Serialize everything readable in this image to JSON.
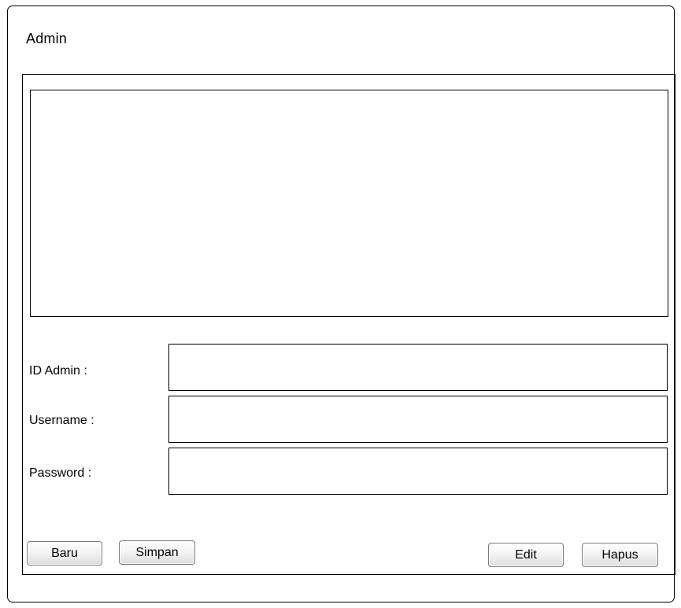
{
  "window": {
    "title": "Admin"
  },
  "form": {
    "fields": [
      {
        "label": "ID Admin :",
        "value": ""
      },
      {
        "label": "Username :",
        "value": ""
      },
      {
        "label": "Password :",
        "value": ""
      }
    ]
  },
  "buttons": {
    "baru": "Baru",
    "simpan": "Simpan",
    "edit": "Edit",
    "hapus": "Hapus"
  }
}
